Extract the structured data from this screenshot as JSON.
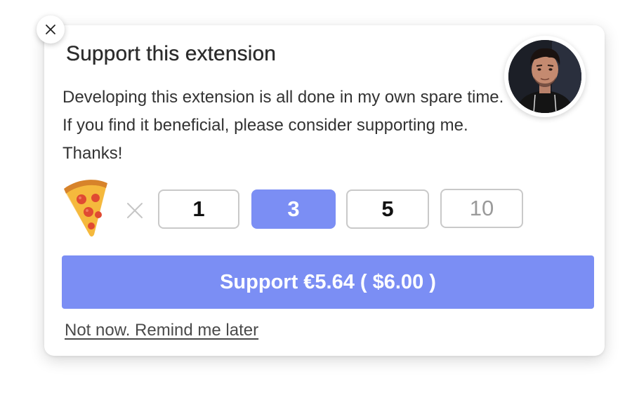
{
  "dialog": {
    "title": "Support this extension",
    "description": "Developing this extension is all done in my own spare time. If you find it beneficial, please consider supporting me. Thanks!",
    "close_icon": "close-icon",
    "avatar_icon": "author-avatar",
    "pizza_icon": "pizza-slice-emoji",
    "multiply_icon": "multiply-icon",
    "quantity_options": [
      "1",
      "3",
      "5",
      "10"
    ],
    "selected_quantity": "3",
    "support_button_label": "Support €5.64 ( $6.00 )",
    "remind_later_label": "Not now. Remind me later"
  },
  "colors": {
    "accent": "#7b8ef4",
    "button_border": "#c9c9c9",
    "muted_text": "#9a9a9a"
  }
}
